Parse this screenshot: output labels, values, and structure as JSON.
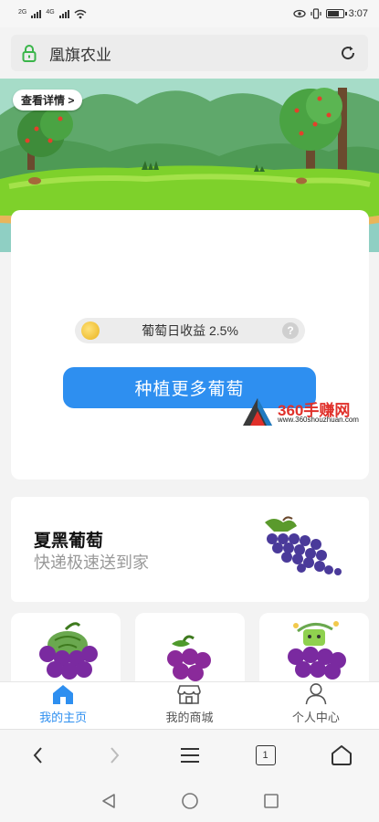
{
  "status_bar": {
    "signal1_label": "2G",
    "signal2_label": "4G",
    "time": "3:07",
    "battery_level": 0.85
  },
  "address_bar": {
    "site_title": "凰旗农业"
  },
  "banner": {
    "details_label": "查看详情 >"
  },
  "main_card": {
    "yield_text": "葡萄日收益 2.5%",
    "help_label": "?",
    "plant_button_label": "种植更多葡萄"
  },
  "watermark": {
    "brand": "360手赚网",
    "url": "www.360shouzhuan.com"
  },
  "promo": {
    "title": "夏黑葡萄",
    "subtitle": "快递极速送到家"
  },
  "tabs": [
    {
      "label": "我的主页",
      "icon": "home-icon",
      "active": true
    },
    {
      "label": "我的商城",
      "icon": "shop-icon",
      "active": false
    },
    {
      "label": "个人中心",
      "icon": "person-icon",
      "active": false
    }
  ],
  "browser": {
    "tab_count": "1"
  },
  "colors": {
    "accent": "#2e8ff0",
    "grape_purple": "#7a2aa0",
    "banner_grass": "#7ed12b"
  }
}
